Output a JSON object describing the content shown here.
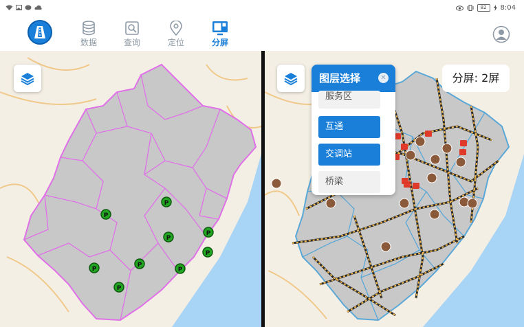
{
  "status_bar": {
    "time": "8:04",
    "battery": "82"
  },
  "nav": {
    "items": [
      {
        "label": "数据",
        "icon": "database-icon"
      },
      {
        "label": "查询",
        "icon": "search-icon"
      },
      {
        "label": "定位",
        "icon": "location-pin-icon"
      },
      {
        "label": "分屏",
        "icon": "split-screen-icon",
        "active": true
      }
    ]
  },
  "right_map": {
    "layer_panel": {
      "title": "图层选择",
      "close_icon": "close-icon",
      "items": [
        {
          "label": "服务区",
          "selected": false
        },
        {
          "label": "互通",
          "selected": true
        },
        {
          "label": "交调站",
          "selected": true
        },
        {
          "label": "桥梁",
          "selected": false
        }
      ]
    },
    "split_label": "分屏: 2屏"
  },
  "colors": {
    "accent": "#1a7fd8",
    "province_fill": "#c8c8c8",
    "left_boundary": "#e070e8",
    "right_boundary": "#5aa8d8",
    "parking_marker": "#22a622",
    "sea": "#a8d4f5"
  }
}
